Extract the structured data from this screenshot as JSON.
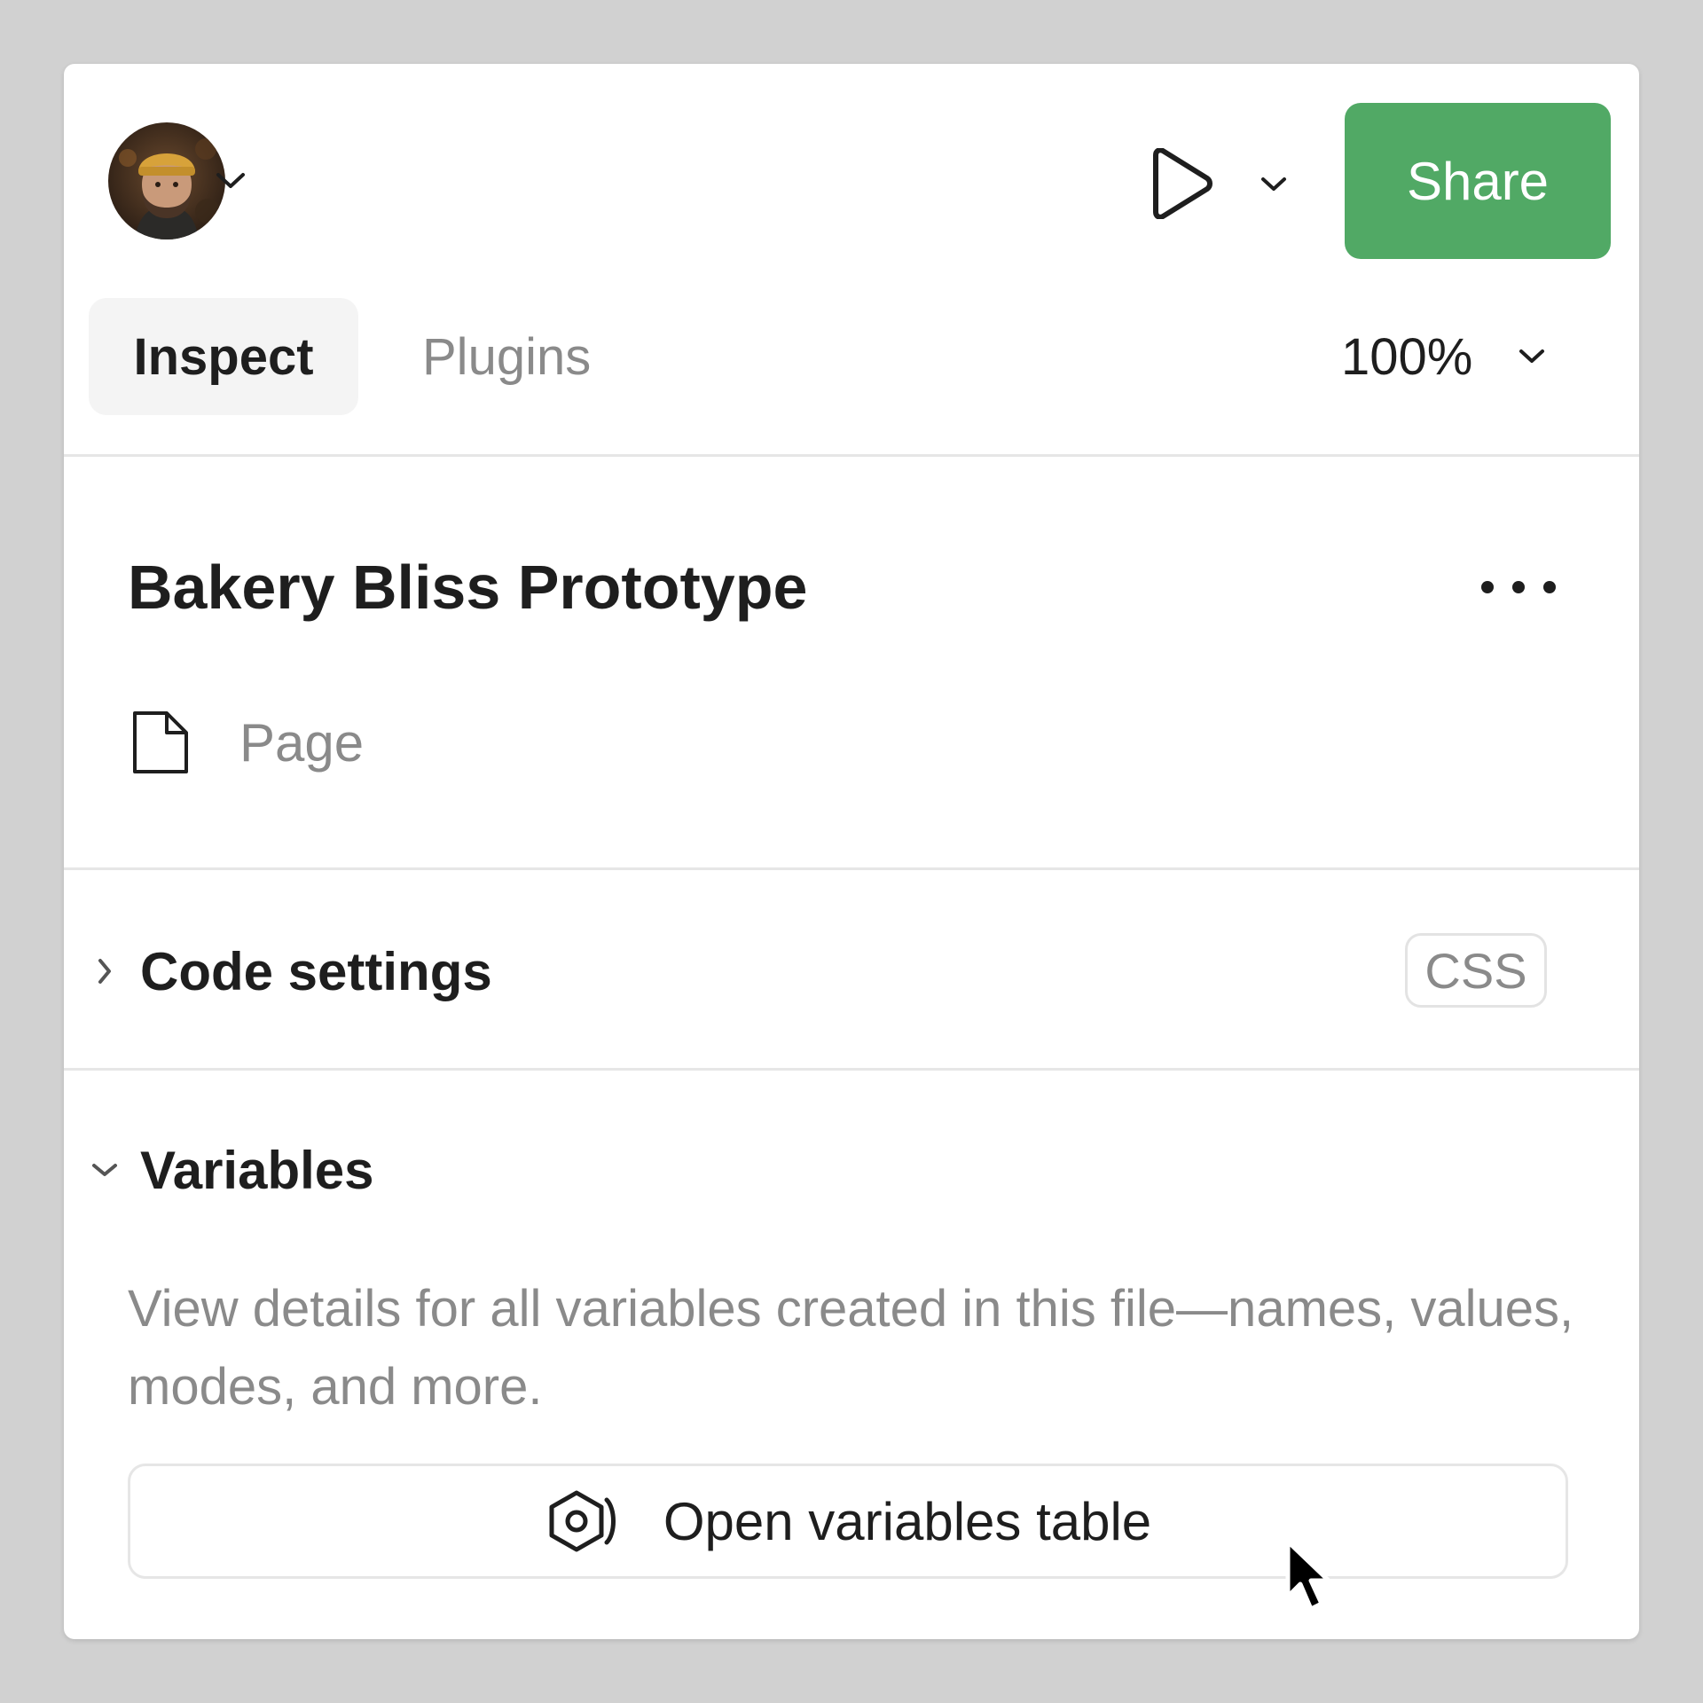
{
  "header": {
    "share_label": "Share"
  },
  "tabs": [
    {
      "label": "Inspect",
      "active": true
    },
    {
      "label": "Plugins",
      "active": false
    }
  ],
  "zoom": {
    "value": "100%"
  },
  "file": {
    "title": "Bakery Bliss Prototype",
    "page_label": "Page"
  },
  "code_settings": {
    "label": "Code settings",
    "language_badge": "CSS",
    "expanded": false
  },
  "variables": {
    "label": "Variables",
    "expanded": true,
    "description": "View details for all variables created in this file—names, values, modes, and more.",
    "button_label": "Open variables table"
  },
  "colors": {
    "accent": "#51a965",
    "background": "#d1d1d1",
    "panel": "#ffffff",
    "text_primary": "#1e1e1e",
    "text_secondary": "#8a8a8a"
  },
  "icons": [
    "chevron-down-icon",
    "play-icon",
    "page-icon",
    "more-icon",
    "chevron-right-icon",
    "variables-icon",
    "mouse-pointer-icon"
  ]
}
